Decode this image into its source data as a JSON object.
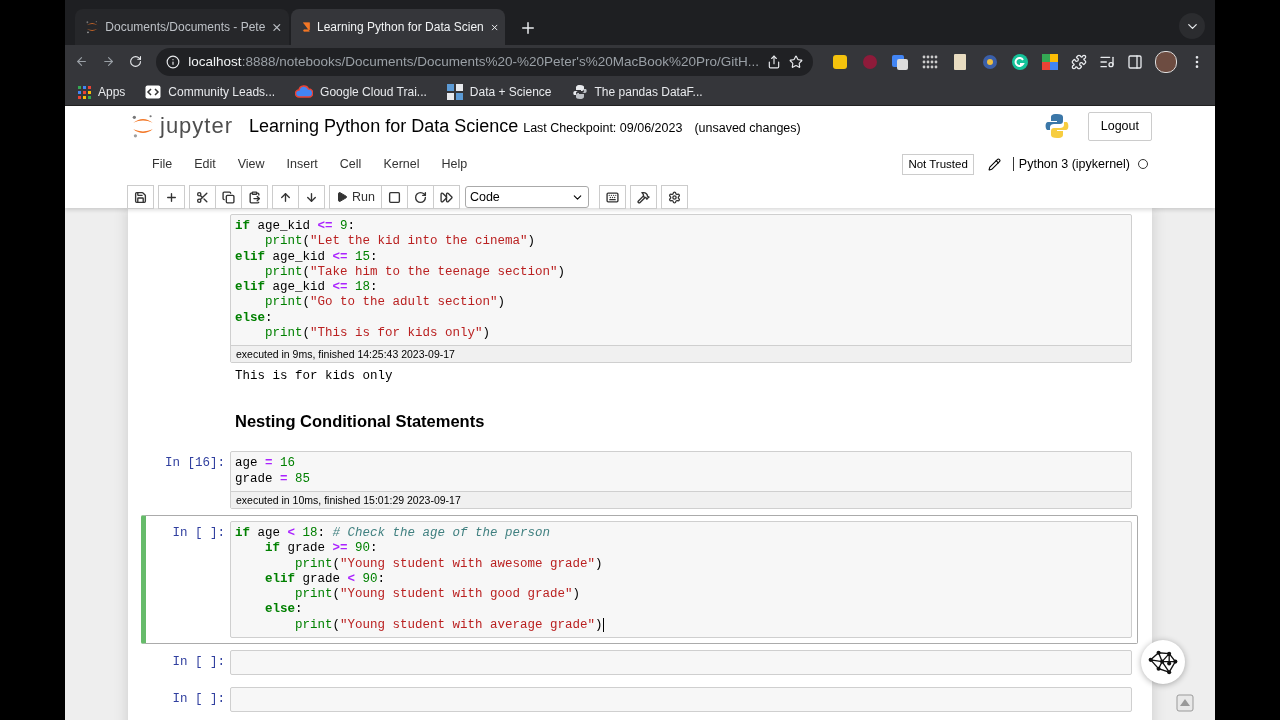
{
  "browser": {
    "tabs": [
      {
        "title": "Documents/Documents - Pete",
        "selected": false
      },
      {
        "title": "Learning Python for Data Scien",
        "selected": true
      }
    ],
    "address": {
      "host": "localhost",
      "path": ":8888/notebooks/Documents/Documents%20-%20Peter's%20MacBook%20Pro/GitH..."
    },
    "bookmarks": [
      {
        "label": "Apps"
      },
      {
        "label": "Community Leads..."
      },
      {
        "label": "Google Cloud Trai..."
      },
      {
        "label": "Data + Science"
      },
      {
        "label": "The pandas DataF..."
      }
    ]
  },
  "jupyter": {
    "logo_text": "jupyter",
    "title": "Learning Python for Data Science",
    "checkpoint": "Last Checkpoint: 09/06/2023",
    "save_status": "(unsaved changes)",
    "logout": "Logout",
    "menu": [
      "File",
      "Edit",
      "View",
      "Insert",
      "Cell",
      "Kernel",
      "Help"
    ],
    "trusted": "Not Trusted",
    "kernel": "Python 3 (ipykernel)",
    "kernel_busy": false,
    "run": "Run",
    "cell_type": "Code"
  },
  "cells": [
    {
      "kind": "code",
      "selected": false,
      "lines": [
        [
          {
            "kind": "keyword",
            "text": "if"
          },
          {
            "kind": "name",
            "text": " age_kid "
          },
          {
            "kind": "operator",
            "text": "<="
          },
          {
            "kind": "number",
            "text": " 9"
          },
          {
            "kind": "name",
            "text": ":"
          }
        ],
        [
          {
            "kind": "builtin",
            "text": "    print"
          },
          {
            "kind": "name",
            "text": "("
          },
          {
            "kind": "string",
            "text": "\"Let the kid into the cinema\""
          },
          {
            "kind": "name",
            "text": ")"
          }
        ],
        [
          {
            "kind": "keyword",
            "text": "elif"
          },
          {
            "kind": "name",
            "text": " age_kid "
          },
          {
            "kind": "operator",
            "text": "<="
          },
          {
            "kind": "number",
            "text": " 15"
          },
          {
            "kind": "name",
            "text": ":"
          }
        ],
        [
          {
            "kind": "builtin",
            "text": "    print"
          },
          {
            "kind": "name",
            "text": "("
          },
          {
            "kind": "string",
            "text": "\"Take him to the teenage section\""
          },
          {
            "kind": "name",
            "text": ")"
          }
        ],
        [
          {
            "kind": "keyword",
            "text": "elif"
          },
          {
            "kind": "name",
            "text": " age_kid "
          },
          {
            "kind": "operator",
            "text": "<="
          },
          {
            "kind": "number",
            "text": " 18"
          },
          {
            "kind": "name",
            "text": ":"
          }
        ],
        [
          {
            "kind": "builtin",
            "text": "    print"
          },
          {
            "kind": "name",
            "text": "("
          },
          {
            "kind": "string",
            "text": "\"Go to the adult section\""
          },
          {
            "kind": "name",
            "text": ")"
          }
        ],
        [
          {
            "kind": "keyword",
            "text": "else"
          },
          {
            "kind": "name",
            "text": ":"
          }
        ],
        [
          {
            "kind": "builtin",
            "text": "    print"
          },
          {
            "kind": "name",
            "text": "("
          },
          {
            "kind": "string",
            "text": "\"This is for kids only\""
          },
          {
            "kind": "name",
            "text": ")"
          }
        ]
      ],
      "timing": "executed in 9ms, finished 14:25:43 2023-09-17",
      "output": "This is for kids only"
    },
    {
      "kind": "markdown",
      "selected": false,
      "heading": "Nesting Conditional Statements"
    },
    {
      "kind": "code",
      "prompt": "In [16]:",
      "selected": false,
      "lines": [
        [
          {
            "kind": "name",
            "text": "age "
          },
          {
            "kind": "operator",
            "text": "="
          },
          {
            "kind": "number",
            "text": " 16"
          }
        ],
        [
          {
            "kind": "name",
            "text": "grade "
          },
          {
            "kind": "operator",
            "text": "="
          },
          {
            "kind": "number",
            "text": " 85"
          }
        ]
      ],
      "timing": "executed in 10ms, finished 15:01:29 2023-09-17"
    },
    {
      "kind": "code",
      "prompt": "In [ ]:",
      "selected": true,
      "lines": [
        [
          {
            "kind": "keyword",
            "text": "if"
          },
          {
            "kind": "name",
            "text": " age "
          },
          {
            "kind": "operator",
            "text": "<"
          },
          {
            "kind": "number",
            "text": " 18"
          },
          {
            "kind": "name",
            "text": ": "
          },
          {
            "kind": "comment",
            "text": "# Check the age of the person"
          }
        ],
        [
          {
            "kind": "keyword",
            "text": "    if"
          },
          {
            "kind": "name",
            "text": " grade "
          },
          {
            "kind": "operator",
            "text": ">="
          },
          {
            "kind": "number",
            "text": " 90"
          },
          {
            "kind": "name",
            "text": ":"
          }
        ],
        [
          {
            "kind": "builtin",
            "text": "        print"
          },
          {
            "kind": "name",
            "text": "("
          },
          {
            "kind": "string",
            "text": "\"Young student with awesome grade\""
          },
          {
            "kind": "name",
            "text": ")"
          }
        ],
        [
          {
            "kind": "keyword",
            "text": "    elif"
          },
          {
            "kind": "name",
            "text": " grade "
          },
          {
            "kind": "operator",
            "text": "<"
          },
          {
            "kind": "number",
            "text": " 90"
          },
          {
            "kind": "name",
            "text": ":"
          }
        ],
        [
          {
            "kind": "builtin",
            "text": "        print"
          },
          {
            "kind": "name",
            "text": "("
          },
          {
            "kind": "string",
            "text": "\"Young student with good grade\""
          },
          {
            "kind": "name",
            "text": ")"
          }
        ],
        [
          {
            "kind": "keyword",
            "text": "    else"
          },
          {
            "kind": "name",
            "text": ":"
          }
        ],
        [
          {
            "kind": "builtin",
            "text": "        print"
          },
          {
            "kind": "name",
            "text": "("
          },
          {
            "kind": "string",
            "text": "\"Young student with average grade\""
          },
          {
            "kind": "name",
            "text": ")"
          }
        ]
      ]
    },
    {
      "kind": "code",
      "prompt": "In [ ]:",
      "selected": false
    },
    {
      "kind": "code",
      "prompt": "In [ ]:",
      "selected": false
    }
  ]
}
